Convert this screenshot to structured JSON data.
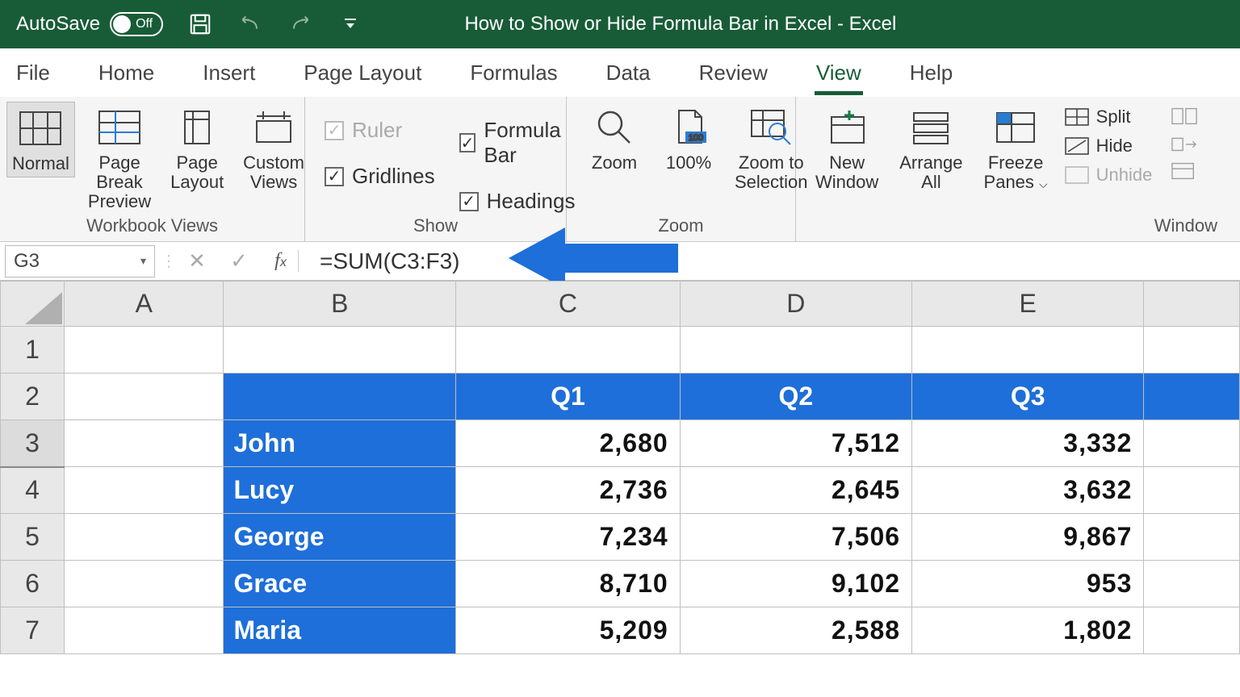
{
  "titlebar": {
    "autosave_label": "AutoSave",
    "autosave_state": "Off",
    "document_title": "How to Show or Hide Formula Bar in Excel  -  Excel"
  },
  "tabs": {
    "file": "File",
    "home": "Home",
    "insert": "Insert",
    "page_layout": "Page Layout",
    "formulas": "Formulas",
    "data": "Data",
    "review": "Review",
    "view": "View",
    "help": "Help"
  },
  "ribbon": {
    "workbook_views": {
      "label": "Workbook Views",
      "normal": "Normal",
      "page_break": "Page Break\nPreview",
      "page_layout": "Page\nLayout",
      "custom_views": "Custom\nViews"
    },
    "show": {
      "label": "Show",
      "ruler": "Ruler",
      "formula_bar": "Formula Bar",
      "gridlines": "Gridlines",
      "headings": "Headings"
    },
    "zoom": {
      "label": "Zoom",
      "zoom": "Zoom",
      "hundred": "100%",
      "zoom_to_selection": "Zoom to\nSelection"
    },
    "window": {
      "label": "Window",
      "new_window": "New\nWindow",
      "arrange_all": "Arrange\nAll",
      "freeze_panes": "Freeze\nPanes",
      "split": "Split",
      "hide": "Hide",
      "unhide": "Unhide"
    }
  },
  "formula_bar": {
    "cell_ref": "G3",
    "formula": "=SUM(C3:F3)"
  },
  "columns": [
    "A",
    "B",
    "C",
    "D",
    "E"
  ],
  "rows": [
    "1",
    "2",
    "3",
    "4",
    "5",
    "6",
    "7"
  ],
  "table": {
    "headers": {
      "q1": "Q1",
      "q2": "Q2",
      "q3": "Q3"
    },
    "data": [
      {
        "name": "John",
        "q1": "2,680",
        "q2": "7,512",
        "q3": "3,332"
      },
      {
        "name": "Lucy",
        "q1": "2,736",
        "q2": "2,645",
        "q3": "3,632"
      },
      {
        "name": "George",
        "q1": "7,234",
        "q2": "7,506",
        "q3": "9,867"
      },
      {
        "name": "Grace",
        "q1": "8,710",
        "q2": "9,102",
        "q3": "953"
      },
      {
        "name": "Maria",
        "q1": "5,209",
        "q2": "2,588",
        "q3": "1,802"
      }
    ]
  }
}
